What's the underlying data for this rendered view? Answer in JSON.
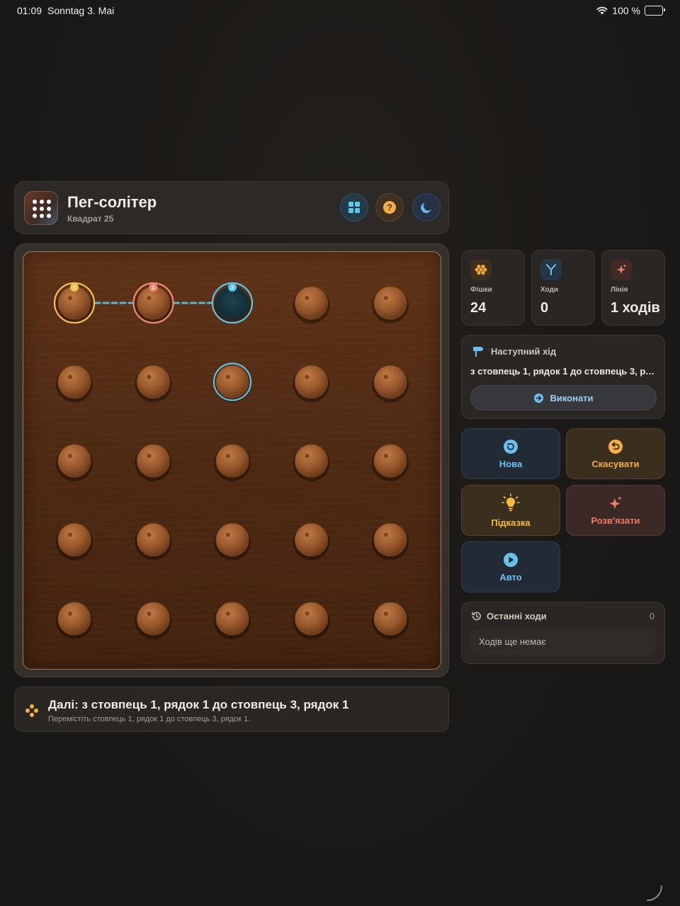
{
  "status_bar": {
    "time": "01:09",
    "date": "Sonntag 3. Mai",
    "battery": "100 %"
  },
  "header": {
    "title": "Пег-солітер",
    "subtitle": "Квадрат 25",
    "icons": [
      "app-grid-dots-icon",
      "layout-grid-icon",
      "help-icon",
      "moon-icon"
    ]
  },
  "board": {
    "rows": 5,
    "cols": 5,
    "pegs": [
      [
        1,
        1,
        0,
        1,
        1
      ],
      [
        1,
        1,
        1,
        1,
        1
      ],
      [
        1,
        1,
        1,
        1,
        1
      ],
      [
        1,
        1,
        1,
        1,
        1
      ],
      [
        1,
        1,
        1,
        1,
        1
      ]
    ],
    "hint_path": [
      {
        "order": "1",
        "row": 1,
        "col": 1,
        "color": "#f2c04e"
      },
      {
        "order": "2",
        "row": 1,
        "col": 2,
        "color": "#f08a78"
      },
      {
        "order": "3",
        "row": 1,
        "col": 3,
        "color": "#5cc4e8"
      }
    ],
    "highlighted_peg": {
      "row": 2,
      "col": 3,
      "color": "#5cc4e8"
    }
  },
  "stats": [
    {
      "label": "Фішки",
      "value": "24",
      "icon": "honeycomb-icon",
      "color": "#f4a63a"
    },
    {
      "label": "Ходи",
      "value": "0",
      "icon": "fork-icon",
      "color": "#6cc0ef"
    },
    {
      "label": "Лінія",
      "value": "1 ходів",
      "icon": "sparkles-icon",
      "color": "#f07a68"
    }
  ],
  "next_move": {
    "title": "Наступний хід",
    "text": "з стовпець 1, рядок 1 до стовпець 3, рядок 1",
    "execute_label": "Виконати"
  },
  "actions": {
    "new_label": "Нова",
    "undo_label": "Скасувати",
    "hint_label": "Підказка",
    "solve_label": "Розв'язати",
    "auto_label": "Авто"
  },
  "history": {
    "title": "Останні ходи",
    "count": "0",
    "empty": "Ходів ще немає"
  },
  "hint_bar": {
    "title": "Далі: з стовпець 1, рядок 1 до стовпець 3, рядок 1",
    "subtitle": "Перемістіть стовпець 1, рядок 1 до стовпець 3, рядок 1."
  },
  "colors": {
    "accent_blue": "#6cc0ef",
    "accent_orange": "#f4ae45",
    "accent_red": "#f07a68",
    "peg": "#9a5a2e"
  }
}
